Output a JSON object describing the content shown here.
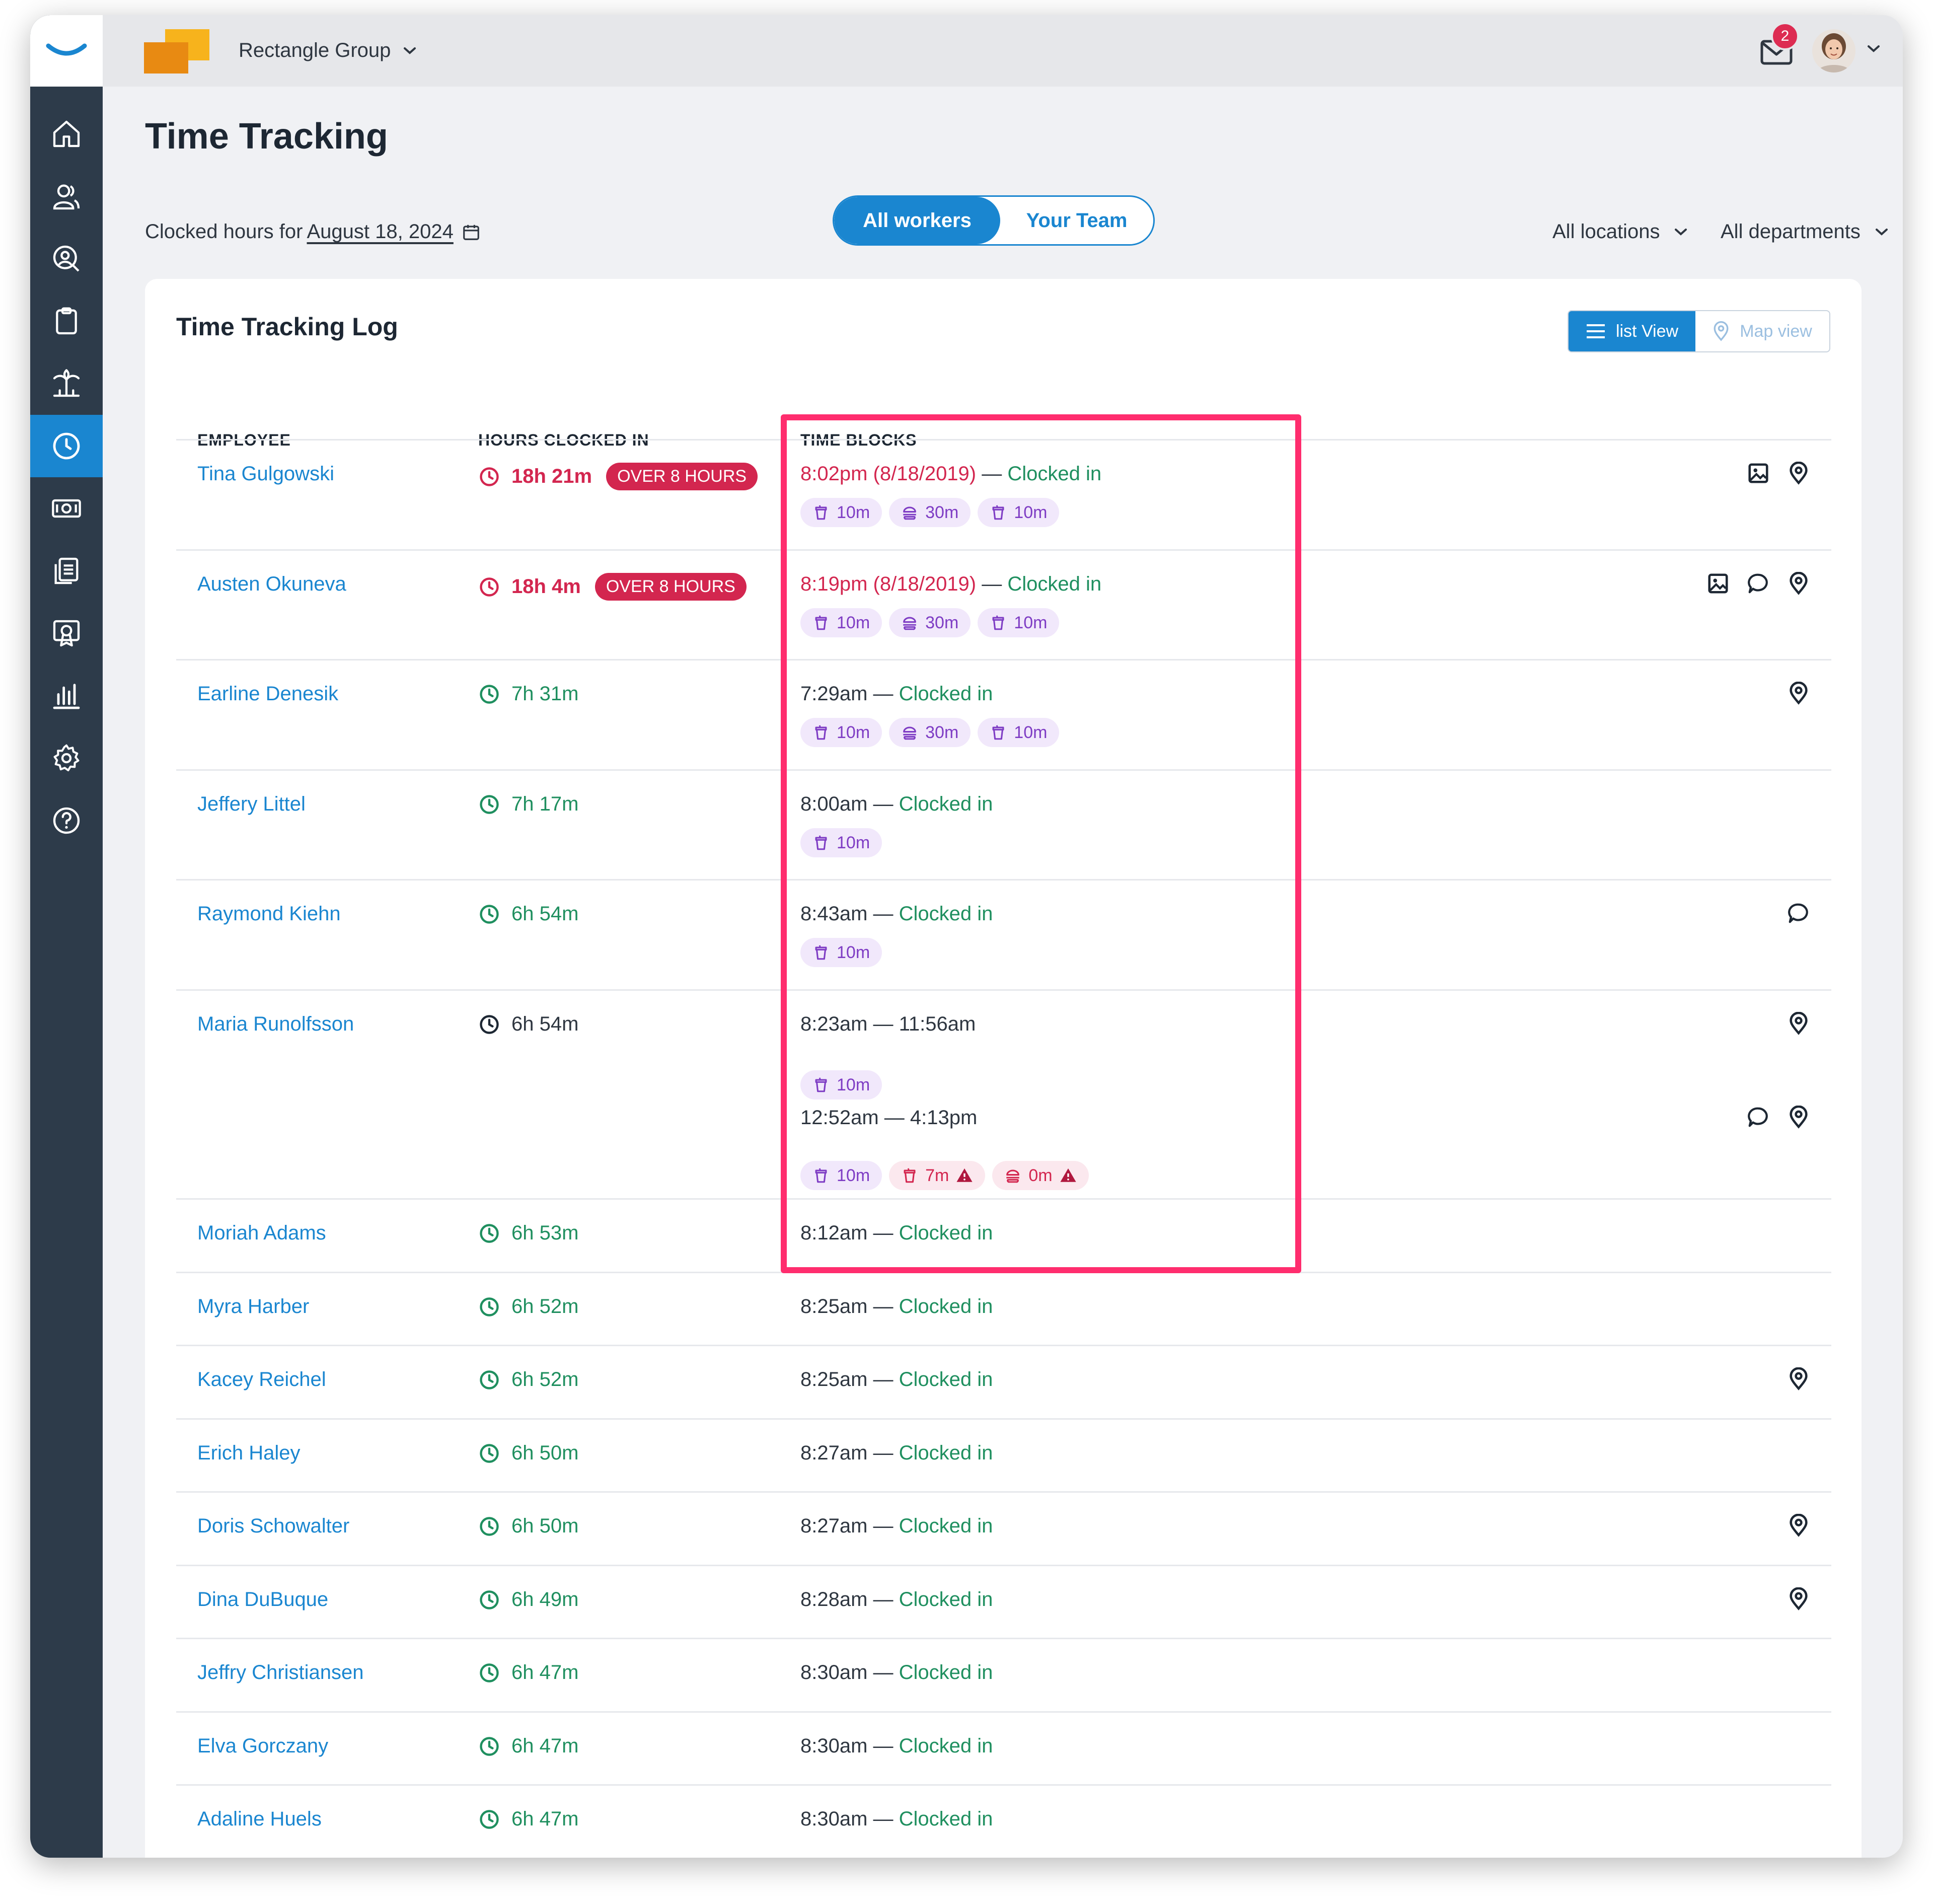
{
  "colors": {
    "accent": "#1a86d0",
    "sidebar": "#2d3b4a",
    "danger": "#d3264f",
    "success": "#1f8f5f",
    "pill_bg": "#f1e8fb",
    "highlight": "#ff2d6e"
  },
  "sidebar": {
    "items": [
      "home-icon",
      "people-icon",
      "person-search-icon",
      "clipboard-icon",
      "vacation-icon",
      "clock-icon",
      "money-icon",
      "documents-icon",
      "certificate-icon",
      "reports-icon",
      "settings-icon",
      "help-icon"
    ],
    "active_index": 5
  },
  "header": {
    "company": "Rectangle Group",
    "notifications": "2"
  },
  "page": {
    "title": "Time Tracking",
    "clocked_label": "Clocked hours for",
    "date": "August 18, 2024",
    "scope_toggle": [
      "All workers",
      "Your Team"
    ],
    "filters": [
      "All locations",
      "All departments"
    ]
  },
  "log": {
    "title": "Time Tracking Log",
    "views": [
      "list View",
      "Map view"
    ],
    "columns": [
      "EMPLOYEE",
      "HOURS CLOCKED IN",
      "TIME BLOCKS"
    ],
    "over_label": "OVER 8 HOURS",
    "rows": [
      {
        "name": "Tina Gulgowski",
        "hours": "18h 21m",
        "over": true,
        "time": "8:02pm (8/18/2019)",
        "status": "Clocked in",
        "pills": [
          "10m",
          "30m",
          "10m"
        ],
        "actions": [
          "image-icon",
          "location-icon"
        ]
      },
      {
        "name": "Austen Okuneva",
        "hours": "18h 4m",
        "over": true,
        "time": "8:19pm  (8/18/2019)",
        "status": "Clocked in",
        "pills": [
          "10m",
          "30m",
          "10m"
        ],
        "actions": [
          "image-icon",
          "comment-icon",
          "location-icon"
        ]
      },
      {
        "name": "Earline Denesik",
        "hours": "7h 31m",
        "time": "7:29am",
        "status": "Clocked in",
        "pills": [
          "10m",
          "30m",
          "10m"
        ],
        "actions": [
          "location-icon"
        ]
      },
      {
        "name": "Jeffery Littel",
        "hours": "7h 17m",
        "time": "8:00am",
        "status": "Clocked in",
        "pills": [
          "10m"
        ],
        "actions": []
      },
      {
        "name": "Raymond Kiehn",
        "hours": "6h 54m",
        "time": "8:43am",
        "status": "Clocked in",
        "pills": [
          "10m"
        ],
        "actions": [
          "comment-icon"
        ]
      },
      {
        "name": "Maria Runolfsson",
        "hours": "6h 54m",
        "block1": "8:23am — 11:56am",
        "pill1": "10m",
        "block2": "12:52am — 4:13pm",
        "pills2": [
          "10m",
          "7m",
          "0m"
        ],
        "actions1": [
          "location-icon"
        ],
        "actions2": [
          "comment-icon",
          "location-icon"
        ]
      },
      {
        "name": "Moriah Adams",
        "hours": "6h 53m",
        "time": "8:12am",
        "status": "Clocked in"
      },
      {
        "name": "Myra Harber",
        "hours": "6h 52m",
        "time": "8:25am",
        "status": "Clocked in",
        "actions": []
      },
      {
        "name": "Kacey Reichel",
        "hours": "6h 52m",
        "time": "8:25am",
        "status": "Clocked in",
        "actions": [
          "location-icon"
        ]
      },
      {
        "name": "Erich Haley",
        "hours": "6h 50m",
        "time": "8:27am",
        "status": "Clocked in",
        "actions": []
      },
      {
        "name": "Doris Schowalter",
        "hours": "6h 50m",
        "time": "8:27am",
        "status": "Clocked in",
        "actions": [
          "location-icon"
        ]
      },
      {
        "name": "Dina DuBuque",
        "hours": "6h 49m",
        "time": "8:28am",
        "status": "Clocked in",
        "actions": [
          "location-icon"
        ]
      },
      {
        "name": "Jeffry Christiansen",
        "hours": "6h 47m",
        "time": "8:30am",
        "status": "Clocked in",
        "actions": []
      },
      {
        "name": "Elva Gorczany",
        "hours": "6h 47m",
        "time": "8:30am",
        "status": "Clocked in",
        "actions": []
      },
      {
        "name": "Adaline Huels",
        "hours": "6h 47m",
        "time": "8:30am",
        "status": "Clocked in",
        "actions": []
      }
    ]
  }
}
